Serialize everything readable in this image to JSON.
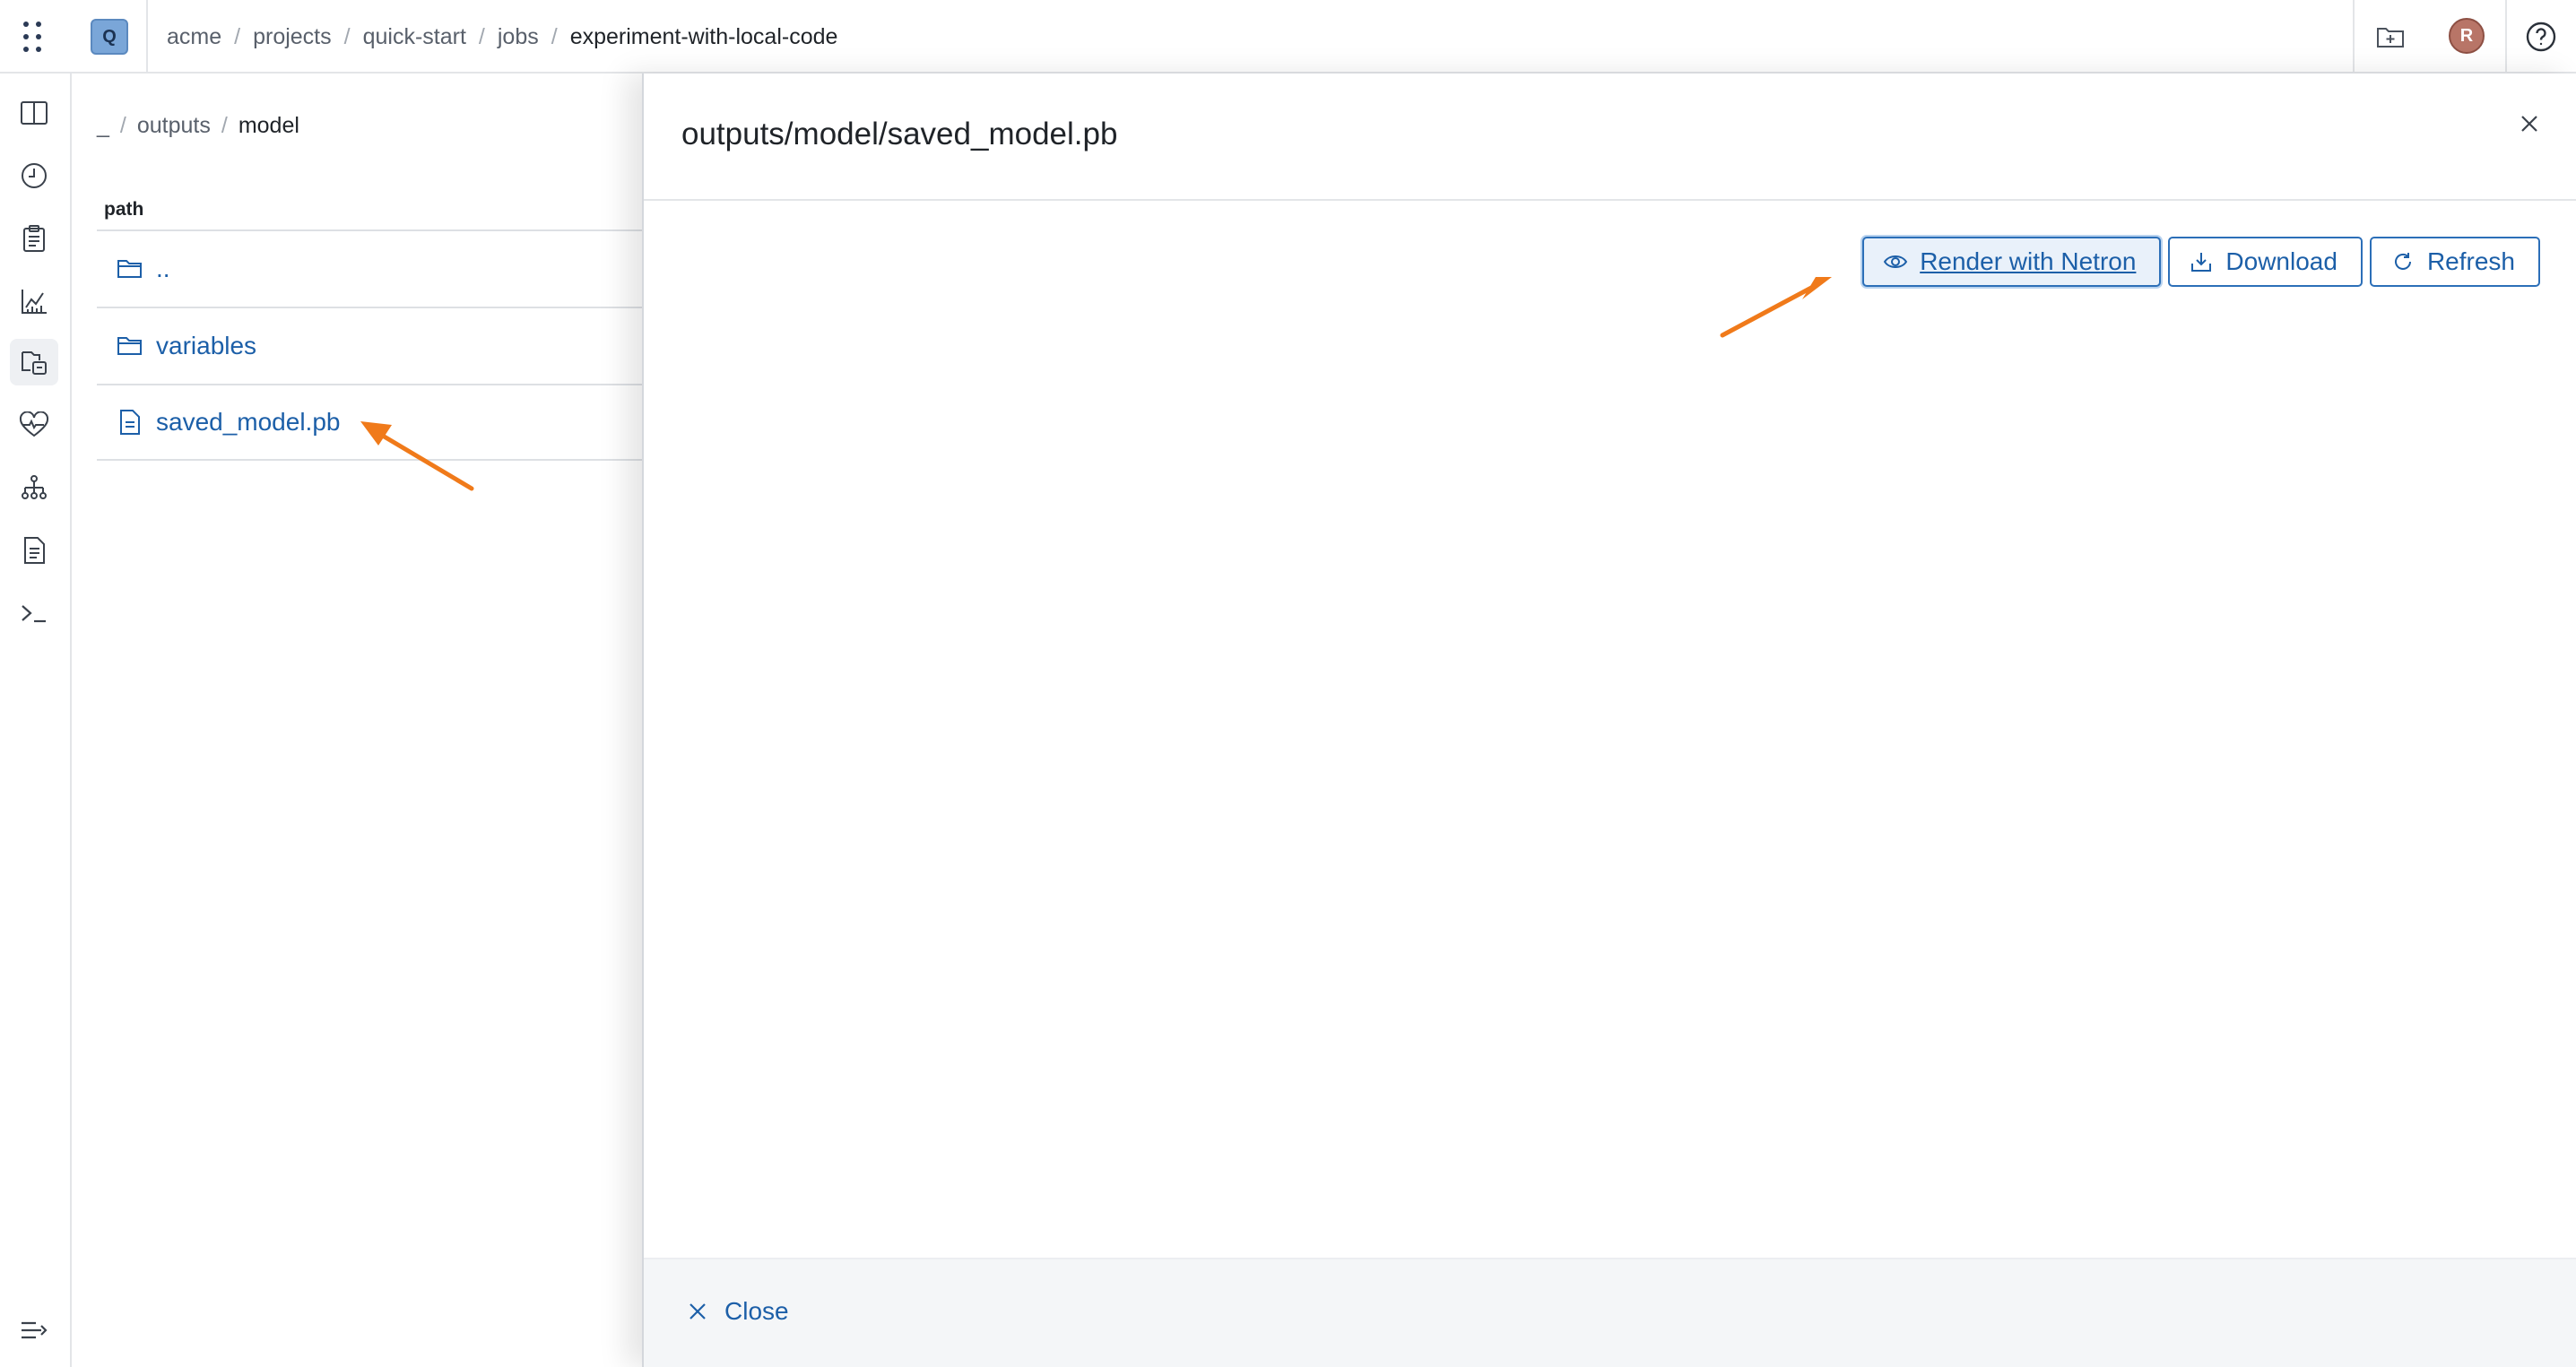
{
  "header": {
    "project_badge": "Q",
    "breadcrumbs": [
      "acme",
      "projects",
      "quick-start",
      "jobs",
      "experiment-with-local-code"
    ],
    "avatar_initial": "R"
  },
  "sidebar": {
    "items": [
      {
        "icon": "columns-icon"
      },
      {
        "icon": "clock-icon"
      },
      {
        "icon": "clipboard-icon"
      },
      {
        "icon": "chart-icon"
      },
      {
        "icon": "artifacts-icon",
        "active": true
      },
      {
        "icon": "heart-pulse-icon"
      },
      {
        "icon": "hierarchy-icon"
      },
      {
        "icon": "document-icon"
      },
      {
        "icon": "terminal-icon"
      }
    ],
    "bottom_icon": "collapse-icon"
  },
  "file_browser": {
    "path_crumbs": [
      "_",
      "outputs",
      "model"
    ],
    "column_header": "path",
    "rows": [
      {
        "name": "..",
        "type": "folder"
      },
      {
        "name": "variables",
        "type": "folder"
      },
      {
        "name": "saved_model.pb",
        "type": "file"
      }
    ]
  },
  "preview_panel": {
    "title": "outputs/model/saved_model.pb",
    "buttons": {
      "netron": "Render with Netron",
      "download": "Download",
      "refresh": "Refresh"
    },
    "close_label": "Close"
  },
  "colors": {
    "link": "#1c5fa8",
    "accent_border": "#2c6fb8",
    "annotation_arrow": "#f07a1a"
  }
}
